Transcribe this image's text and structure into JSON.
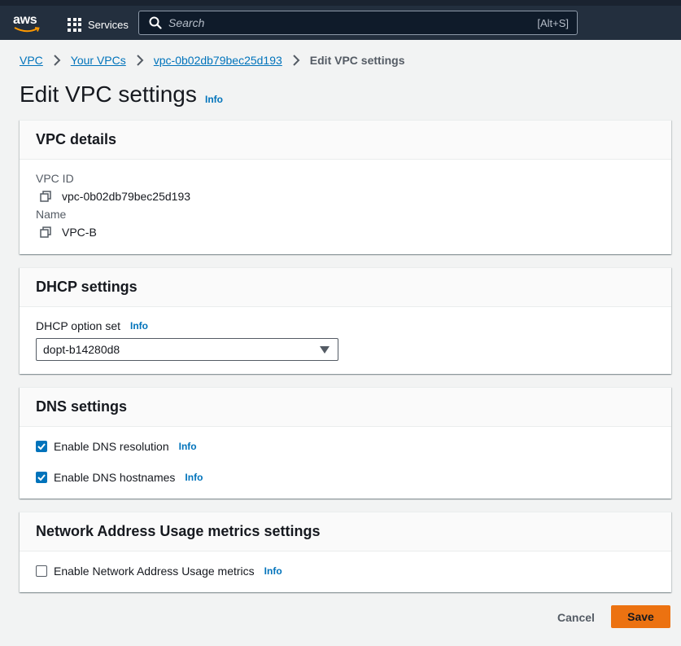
{
  "topnav": {
    "logo_text": "aws",
    "services_label": "Services",
    "search_placeholder": "Search",
    "search_shortcut": "[Alt+S]"
  },
  "breadcrumb": {
    "items": [
      "VPC",
      "Your VPCs",
      "vpc-0b02db79bec25d193"
    ],
    "current": "Edit VPC settings"
  },
  "page": {
    "title": "Edit VPC settings",
    "info": "Info"
  },
  "vpc_details": {
    "title": "VPC details",
    "vpc_id_label": "VPC ID",
    "vpc_id_value": "vpc-0b02db79bec25d193",
    "name_label": "Name",
    "name_value": "VPC-B"
  },
  "dhcp": {
    "title": "DHCP settings",
    "option_label": "DHCP option set",
    "info": "Info",
    "selected_value": "dopt-b14280d8"
  },
  "dns": {
    "title": "DNS settings",
    "resolution_label": "Enable DNS resolution",
    "resolution_checked": true,
    "hostnames_label": "Enable DNS hostnames",
    "hostnames_checked": true,
    "info": "Info"
  },
  "nau": {
    "title": "Network Address Usage metrics settings",
    "metrics_label": "Enable Network Address Usage metrics",
    "metrics_checked": false,
    "info": "Info"
  },
  "actions": {
    "cancel": "Cancel",
    "save": "Save"
  },
  "colors": {
    "nav_bg": "#232f3e",
    "link": "#0073bb",
    "primary_button": "#ec7211"
  }
}
